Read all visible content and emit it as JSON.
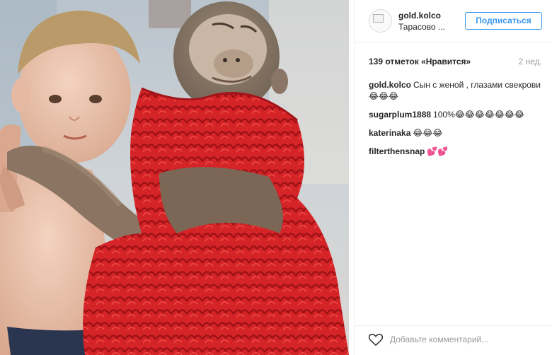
{
  "post": {
    "username": "gold.kolco",
    "location": "Тарасово ...",
    "follow_label": "Подписаться",
    "likes_text": "139 отметок «Нравится»",
    "time_ago": "2 нед.",
    "comments": [
      {
        "author": "gold.kolco",
        "text": "Сын с женой , глазами свекрови 😂😂😂"
      },
      {
        "author": "sugarplum1888",
        "text": "100%😂😂😂😂😂😂😂"
      },
      {
        "author": "katerinaka",
        "text": "😂😂😂"
      },
      {
        "author": "filterthensnap",
        "text": "💕💕"
      }
    ],
    "comment_placeholder": "Добавьте комментарий..."
  },
  "icons": {
    "like": "heart-outline-icon",
    "avatar": "broken-image-icon"
  },
  "colors": {
    "accent": "#3897f0",
    "dress": "#d8262a",
    "text": "#262626",
    "muted": "#999999"
  }
}
